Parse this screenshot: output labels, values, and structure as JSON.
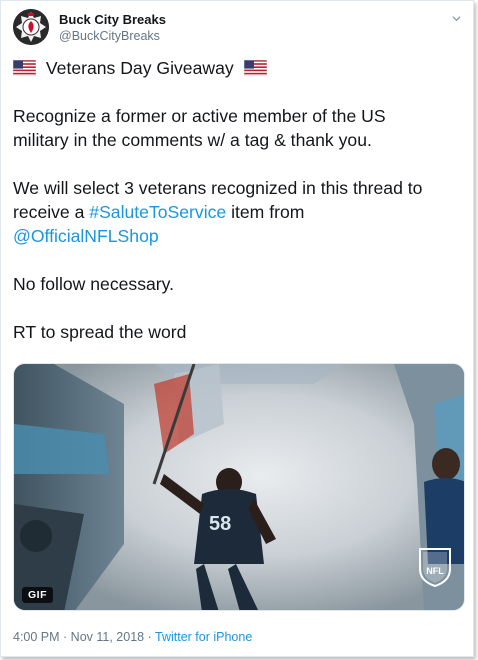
{
  "author": {
    "name": "Buck City Breaks",
    "handle": "@BuckCityBreaks"
  },
  "icons": {
    "avatar": "fire-department-badge-icon",
    "menu": "chevron-down-icon",
    "flag": "us-flag-icon",
    "media_watermark": "nfl-shield-icon"
  },
  "tweet": {
    "title": "Veterans Day Giveaway",
    "para1_line1": "Recognize a former or active member of the US",
    "para1_line2": "military in the comments w/ a tag & thank you.",
    "para2_line1": "We will select 3 veterans recognized in this thread to",
    "para2_line2_prefix": "receive a ",
    "hashtag": "#SaluteToService",
    "para2_line2_suffix": " item from",
    "mention": "@OfficialNFLShop",
    "para3": "No follow necessary.",
    "para4": "RT to spread the word"
  },
  "media": {
    "badge": "GIF",
    "watermark_text": "NFL",
    "jersey_number": "58"
  },
  "footer": {
    "time": "4:00 PM",
    "sep1": " · ",
    "date": "Nov 11, 2018",
    "sep2": " · ",
    "source": "Twitter for iPhone"
  },
  "colors": {
    "link": "#1b95e0",
    "text": "#14171a",
    "secondary": "#657786"
  }
}
